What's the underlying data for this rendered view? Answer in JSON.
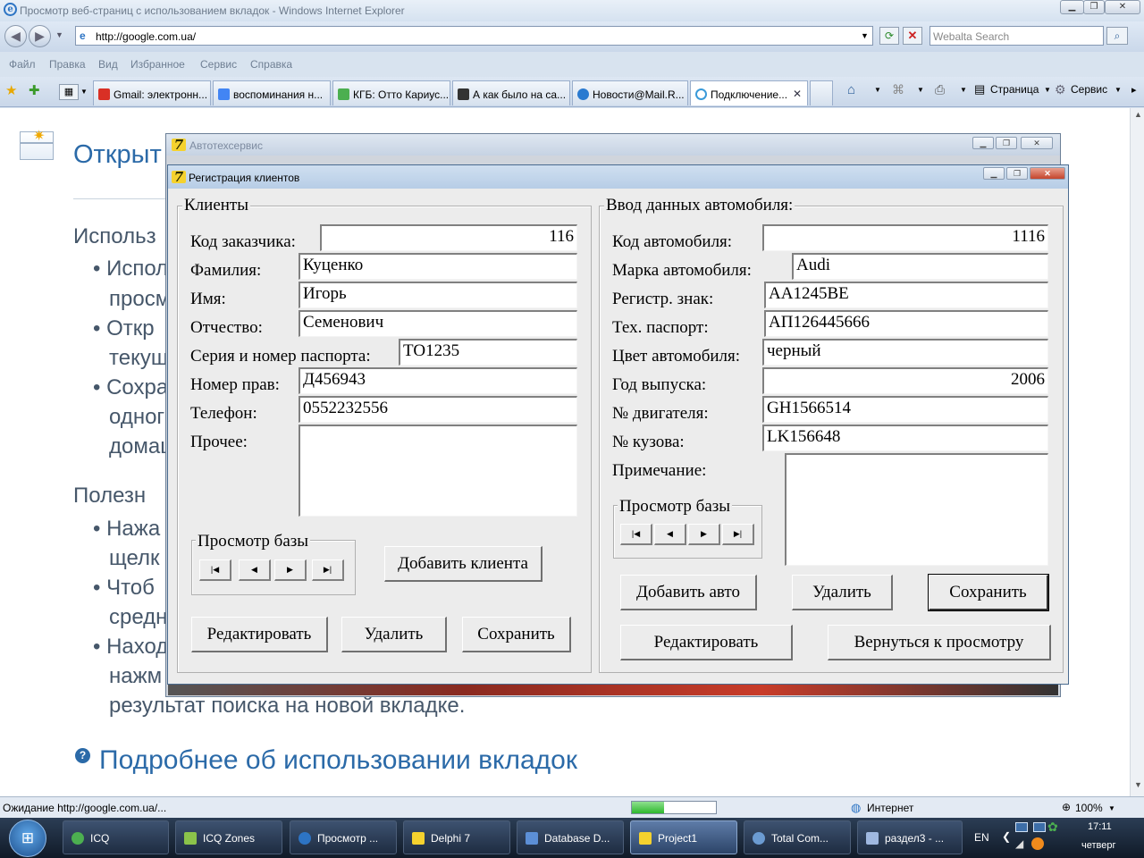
{
  "ie": {
    "title": "Просмотр веб-страниц с использованием вкладок - Windows Internet Explorer",
    "url": "http://google.com.ua/",
    "search_placeholder": "Webalta Search",
    "menu": [
      "Файл",
      "Правка",
      "Вид",
      "Избранное",
      "Сервис",
      "Справка"
    ],
    "tabs": [
      {
        "label": "Gmail: электронн...",
        "color": "#d93025"
      },
      {
        "label": "воспоминания н...",
        "color": "#4285f4"
      },
      {
        "label": "КГБ: Отто Кариус...",
        "color": "#4caf50"
      },
      {
        "label": "А как было на са...",
        "color": "#333333"
      },
      {
        "label": "Новости@Mail.R...",
        "color": "#2a7ad0"
      },
      {
        "label": "Подключение...",
        "color": "#3a9ad9"
      }
    ],
    "tools_page": "Страница",
    "tools_service": "Сервис"
  },
  "page": {
    "heading": "Открыт",
    "line1": "Использ",
    "bullets": [
      "Испол",
      "просм",
      "Откр",
      "текущ",
      "Сохра",
      "одног",
      "домаш"
    ],
    "useful": "Полезн",
    "bullets2": [
      "Нажа",
      "щелк",
      "Чтоб",
      "средн",
      "Наход",
      "нажм"
    ],
    "tail": "результат поиска на новой вкладке.",
    "more_link": "Подробнее об использовании вкладок"
  },
  "status": {
    "text": "Ожидание http://google.com.ua/...",
    "progress": 0.38,
    "zone": "Интернет",
    "zoom": "100%"
  },
  "taskbar": {
    "items": [
      {
        "label": "ICQ",
        "color": "#4caf50"
      },
      {
        "label": "ICQ Zones",
        "color": "#8bc34a"
      },
      {
        "label": "Просмотр ...",
        "color": "#2d74c4"
      },
      {
        "label": "Delphi 7",
        "color": "#f5d22e"
      },
      {
        "label": "Database D...",
        "color": "#5c8fd6"
      },
      {
        "label": "Project1",
        "color": "#f5d22e"
      },
      {
        "label": "Total Com...",
        "color": "#6b9bd1"
      },
      {
        "label": "раздел3 - ...",
        "color": "#9fb8e0"
      }
    ],
    "lang": "EN",
    "time": "17:11",
    "day": "четверг"
  },
  "back_window": {
    "title": "Автотехсервис"
  },
  "form": {
    "title": "Регистрация клиентов",
    "clients": {
      "group": "Клиенты",
      "labels": {
        "code": "Код заказчика:",
        "surname": "Фамилия:",
        "name": "Имя:",
        "patronymic": "Отчество:",
        "passport": "Серия и номер паспорта:",
        "license": "Номер прав:",
        "phone": "Телефон:",
        "other": "Прочее:"
      },
      "values": {
        "code": "116",
        "surname": "Куценко",
        "name": "Игорь",
        "patronymic": "Семенович",
        "passport": "ТО1235",
        "license": "Д456943",
        "phone": "0552232556"
      },
      "browse_group": "Просмотр базы",
      "add_button": "Добавить клиента",
      "edit_button": "Редактировать",
      "delete_button": "Удалить",
      "save_button": "Сохранить"
    },
    "car": {
      "group": "Ввод данных автомобиля:",
      "labels": {
        "code": "Код автомобиля:",
        "brand": "Марка автомобиля:",
        "reg": "Регистр. знак:",
        "tech": "Тех. паспорт:",
        "color": "Цвет автомобиля:",
        "year": "Год выпуска:",
        "engine": "№ двигателя:",
        "body": "№ кузова:",
        "note": "Примечание:"
      },
      "values": {
        "code": "1116",
        "brand": "Audi",
        "reg": "АА1245ВЕ",
        "tech": "АП126445666",
        "color": "черный",
        "year": "2006",
        "engine": "GH1566514",
        "body": "LK156648"
      },
      "browse_group": "Просмотр базы",
      "add_button": "Добавить авто",
      "delete_button": "Удалить",
      "save_button": "Сохранить",
      "edit_button": "Редактировать",
      "back_button": "Вернуться к просмотру"
    },
    "nav_glyphs": {
      "first": "|◀",
      "prev": "◀",
      "next": "▶",
      "last": "▶|"
    }
  }
}
